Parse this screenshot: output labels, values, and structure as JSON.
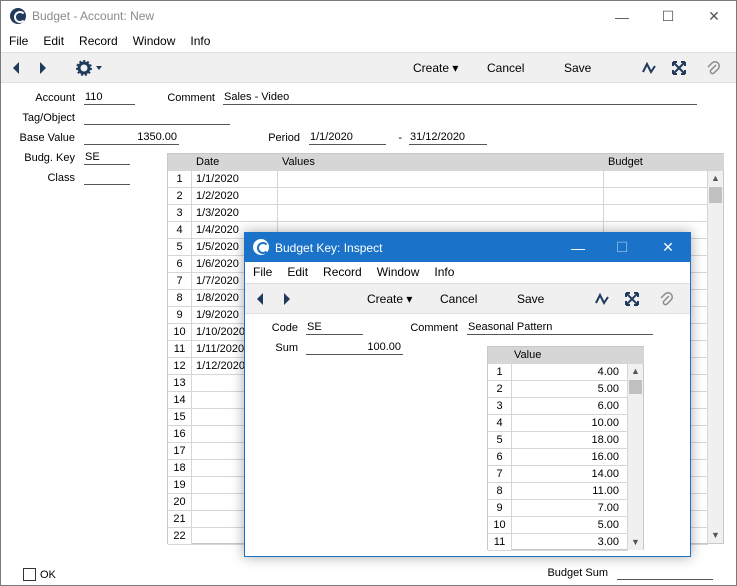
{
  "main": {
    "title": "Budget - Account: New",
    "window_controls": {
      "minimize": "—",
      "maximize": "☐",
      "close": "✕"
    },
    "menu": [
      "File",
      "Edit",
      "Record",
      "Window",
      "Info"
    ],
    "toolbar": {
      "create": "Create",
      "cancel": "Cancel",
      "save": "Save"
    },
    "fields": {
      "account_label": "Account",
      "account_value": "110",
      "comment_label": "Comment",
      "comment_value": "Sales - Video",
      "tag_label": "Tag/Object",
      "tag_value": "",
      "base_value_label": "Base Value",
      "base_value_value": "1350.00",
      "period_label": "Period",
      "period_from": "1/1/2020",
      "period_sep": "-",
      "period_to": "31/12/2020",
      "budg_key_label": "Budg. Key",
      "budg_key_value": "SE",
      "class_label": "Class",
      "class_value": ""
    },
    "grid": {
      "headers": {
        "date": "Date",
        "values": "Values",
        "budget": "Budget"
      },
      "rows": [
        {
          "n": "1",
          "date": "1/1/2020"
        },
        {
          "n": "2",
          "date": "1/2/2020"
        },
        {
          "n": "3",
          "date": "1/3/2020"
        },
        {
          "n": "4",
          "date": "1/4/2020"
        },
        {
          "n": "5",
          "date": "1/5/2020"
        },
        {
          "n": "6",
          "date": "1/6/2020"
        },
        {
          "n": "7",
          "date": "1/7/2020"
        },
        {
          "n": "8",
          "date": "1/8/2020"
        },
        {
          "n": "9",
          "date": "1/9/2020"
        },
        {
          "n": "10",
          "date": "1/10/2020"
        },
        {
          "n": "11",
          "date": "1/11/2020"
        },
        {
          "n": "12",
          "date": "1/12/2020"
        },
        {
          "n": "13",
          "date": ""
        },
        {
          "n": "14",
          "date": ""
        },
        {
          "n": "15",
          "date": ""
        },
        {
          "n": "16",
          "date": ""
        },
        {
          "n": "17",
          "date": ""
        },
        {
          "n": "18",
          "date": ""
        },
        {
          "n": "19",
          "date": ""
        },
        {
          "n": "20",
          "date": ""
        },
        {
          "n": "21",
          "date": ""
        },
        {
          "n": "22",
          "date": ""
        }
      ]
    },
    "footer": {
      "ok_label": "OK",
      "budget_sum_label": "Budget Sum",
      "budget_sum_value": ""
    }
  },
  "dialog": {
    "title": "Budget Key: Inspect",
    "window_controls": {
      "minimize": "—",
      "maximize": "☐",
      "close": "✕"
    },
    "menu": [
      "File",
      "Edit",
      "Record",
      "Window",
      "Info"
    ],
    "toolbar": {
      "create": "Create",
      "cancel": "Cancel",
      "save": "Save"
    },
    "fields": {
      "code_label": "Code",
      "code_value": "SE",
      "comment_label": "Comment",
      "comment_value": "Seasonal Pattern",
      "sum_label": "Sum",
      "sum_value": "100.00"
    },
    "grid": {
      "header": "Value",
      "rows": [
        {
          "n": "1",
          "v": "4.00"
        },
        {
          "n": "2",
          "v": "5.00"
        },
        {
          "n": "3",
          "v": "6.00"
        },
        {
          "n": "4",
          "v": "10.00"
        },
        {
          "n": "5",
          "v": "18.00"
        },
        {
          "n": "6",
          "v": "16.00"
        },
        {
          "n": "7",
          "v": "14.00"
        },
        {
          "n": "8",
          "v": "11.00"
        },
        {
          "n": "9",
          "v": "7.00"
        },
        {
          "n": "10",
          "v": "5.00"
        },
        {
          "n": "11",
          "v": "3.00"
        }
      ]
    }
  },
  "icons": {
    "back": "back-arrow-icon",
    "forward": "forward-arrow-icon",
    "gear": "gear-icon",
    "activity": "activity-icon",
    "fullscreen": "expand-icon",
    "attach": "paperclip-icon"
  },
  "colors": {
    "dialog_accent": "#1a73c8",
    "toolbar_bg": "#f0f0f0",
    "grid_header_bg": "#d6d6d6",
    "icon": "#1f3a5c"
  }
}
